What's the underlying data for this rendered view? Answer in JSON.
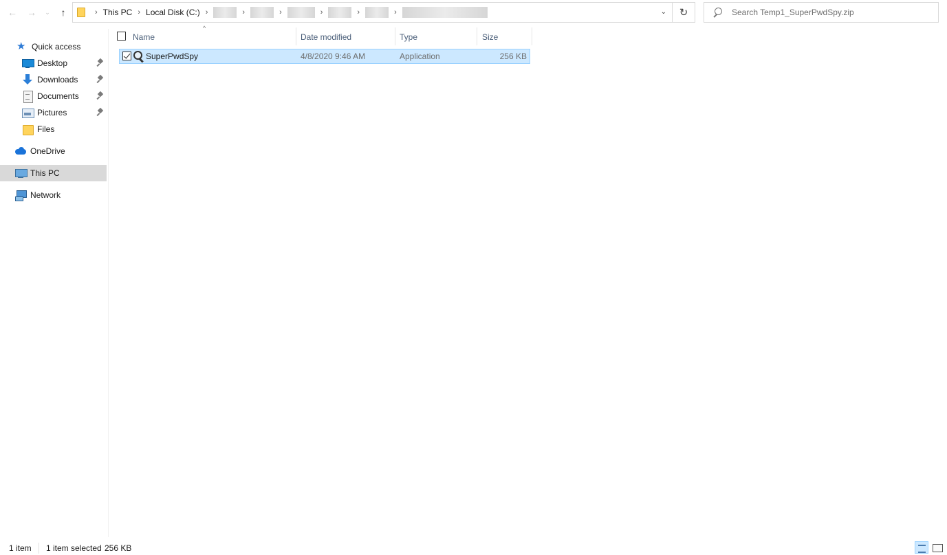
{
  "navigation": {
    "back_glyph": "←",
    "forward_glyph": "→",
    "recent_glyph": "⌄",
    "up_glyph": "↑"
  },
  "address_bar": {
    "crumbs": [
      "This PC",
      "Local Disk (C:)"
    ],
    "redacted_segments": 6,
    "dropdown_glyph": "⌄",
    "refresh_glyph": "↻"
  },
  "search": {
    "placeholder": "Search Temp1_SuperPwdSpy.zip"
  },
  "sidebar": {
    "items": [
      {
        "label": "Quick access",
        "icon": "star-icon",
        "pinned": false
      },
      {
        "label": "Desktop",
        "icon": "desktop-icon",
        "pinned": true
      },
      {
        "label": "Downloads",
        "icon": "downloads-icon",
        "pinned": true
      },
      {
        "label": "Documents",
        "icon": "documents-icon",
        "pinned": true
      },
      {
        "label": "Pictures",
        "icon": "pictures-icon",
        "pinned": true
      },
      {
        "label": "Files",
        "icon": "folder-icon",
        "pinned": false
      },
      {
        "label": "OneDrive",
        "icon": "onedrive-icon",
        "pinned": false
      },
      {
        "label": "This PC",
        "icon": "this-pc-icon",
        "pinned": false,
        "selected": true
      },
      {
        "label": "Network",
        "icon": "network-icon",
        "pinned": false
      }
    ]
  },
  "file_list": {
    "sort_glyph": "^",
    "columns": [
      "Name",
      "Date modified",
      "Type",
      "Size"
    ],
    "rows": [
      {
        "name": "SuperPwdSpy",
        "date_modified": "4/8/2020 9:46 AM",
        "type": "Application",
        "size": "256 KB",
        "selected": true,
        "checked": true
      }
    ]
  },
  "status_bar": {
    "item_count": "1 item",
    "selection": "1 item selected",
    "selection_size": "256 KB"
  },
  "colors": {
    "selection_fill": "#cce8ff",
    "selection_border": "#99d1ff",
    "nav_selected": "#d9d9d9",
    "header_text": "#4c607a"
  }
}
